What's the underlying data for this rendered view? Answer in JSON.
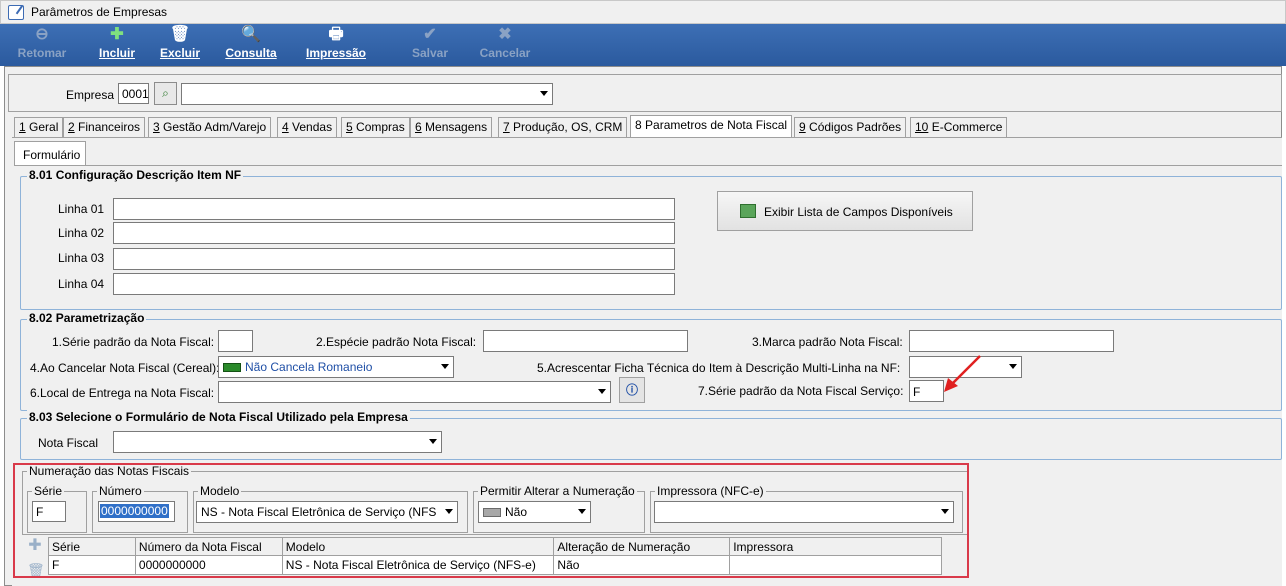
{
  "window": {
    "title": "Parâmetros de Empresas"
  },
  "toolbar": {
    "retomar": "Retomar",
    "incluir": "Incluir",
    "excluir": "Excluir",
    "consulta": "Consulta",
    "impressao": "Impressão",
    "salvar": "Salvar",
    "cancelar": "Cancelar"
  },
  "empresa": {
    "label": "Empresa",
    "code": "0001",
    "name": ""
  },
  "tabs": [
    {
      "num": "1",
      "label": "Geral"
    },
    {
      "num": "2",
      "label": "Financeiros"
    },
    {
      "num": "3",
      "label": "Gestão Adm/Varejo"
    },
    {
      "num": "4",
      "label": "Vendas"
    },
    {
      "num": "5",
      "label": "Compras"
    },
    {
      "num": "6",
      "label": "Mensagens"
    },
    {
      "num": "7",
      "label": "Produção, OS, CRM"
    },
    {
      "num": "8",
      "label": "Parametros de Nota Fiscal"
    },
    {
      "num": "9",
      "label": "Códigos Padrões"
    },
    {
      "num": "10",
      "label": "E-Commerce"
    }
  ],
  "subtab": {
    "label": "Formulário"
  },
  "s801": {
    "title": "8.01 Configuração Descrição Item NF",
    "linha01": "Linha 01",
    "linha02": "Linha 02",
    "linha03": "Linha 03",
    "linha04": "Linha 04",
    "exibir_button": "Exibir Lista de Campos Disponíveis"
  },
  "s802": {
    "title": "8.02 Parametrização",
    "serie_label": "1.Série padrão da Nota Fiscal:",
    "especie_label": "2.Espécie padrão Nota Fiscal:",
    "marca_label": "3.Marca padrão Nota Fiscal:",
    "cancelar_label": "4.Ao Cancelar Nota Fiscal (Cereal):",
    "cancelar_value": "Não Cancela Romaneio",
    "ficha_label": "5.Acrescentar Ficha Técnica do Item à Descrição Multi-Linha na NF:",
    "local_label": "6.Local de Entrega na Nota Fiscal:",
    "serie_servico_label": "7.Série padrão da Nota Fiscal Serviço:",
    "serie_servico_value": "F"
  },
  "s803": {
    "title": "8.03 Selecione o Formulário de Nota Fiscal Utilizado pela Empresa",
    "nota_label": "Nota Fiscal"
  },
  "numeracao": {
    "title": "Numeração das Notas Fiscais",
    "serie_label": "Série",
    "serie_value": "F",
    "numero_label": "Número",
    "numero_value": "0000000000",
    "modelo_label": "Modelo",
    "modelo_value": "NS - Nota Fiscal Eletrônica de Serviço (NFS",
    "permitir_label": "Permitir Alterar a Numeração",
    "permitir_value": "Não",
    "impressora_label": "Impressora (NFC-e)",
    "impressora_value": ""
  },
  "grid": {
    "columns": [
      "Série",
      "Número da Nota Fiscal",
      "Modelo",
      "Alteração de Numeração",
      "Impressora"
    ],
    "rows": [
      {
        "serie": "F",
        "numero": "0000000000",
        "modelo": "NS - Nota Fiscal Eletrônica de Serviço (NFS-e)",
        "alteracao": "Não",
        "impressora": ""
      }
    ]
  },
  "colors": {
    "toolbar": "#2f62a8",
    "highlight_box": "#d93a4a",
    "arrow": "#e02020",
    "section_border": "#8fb3d9"
  }
}
